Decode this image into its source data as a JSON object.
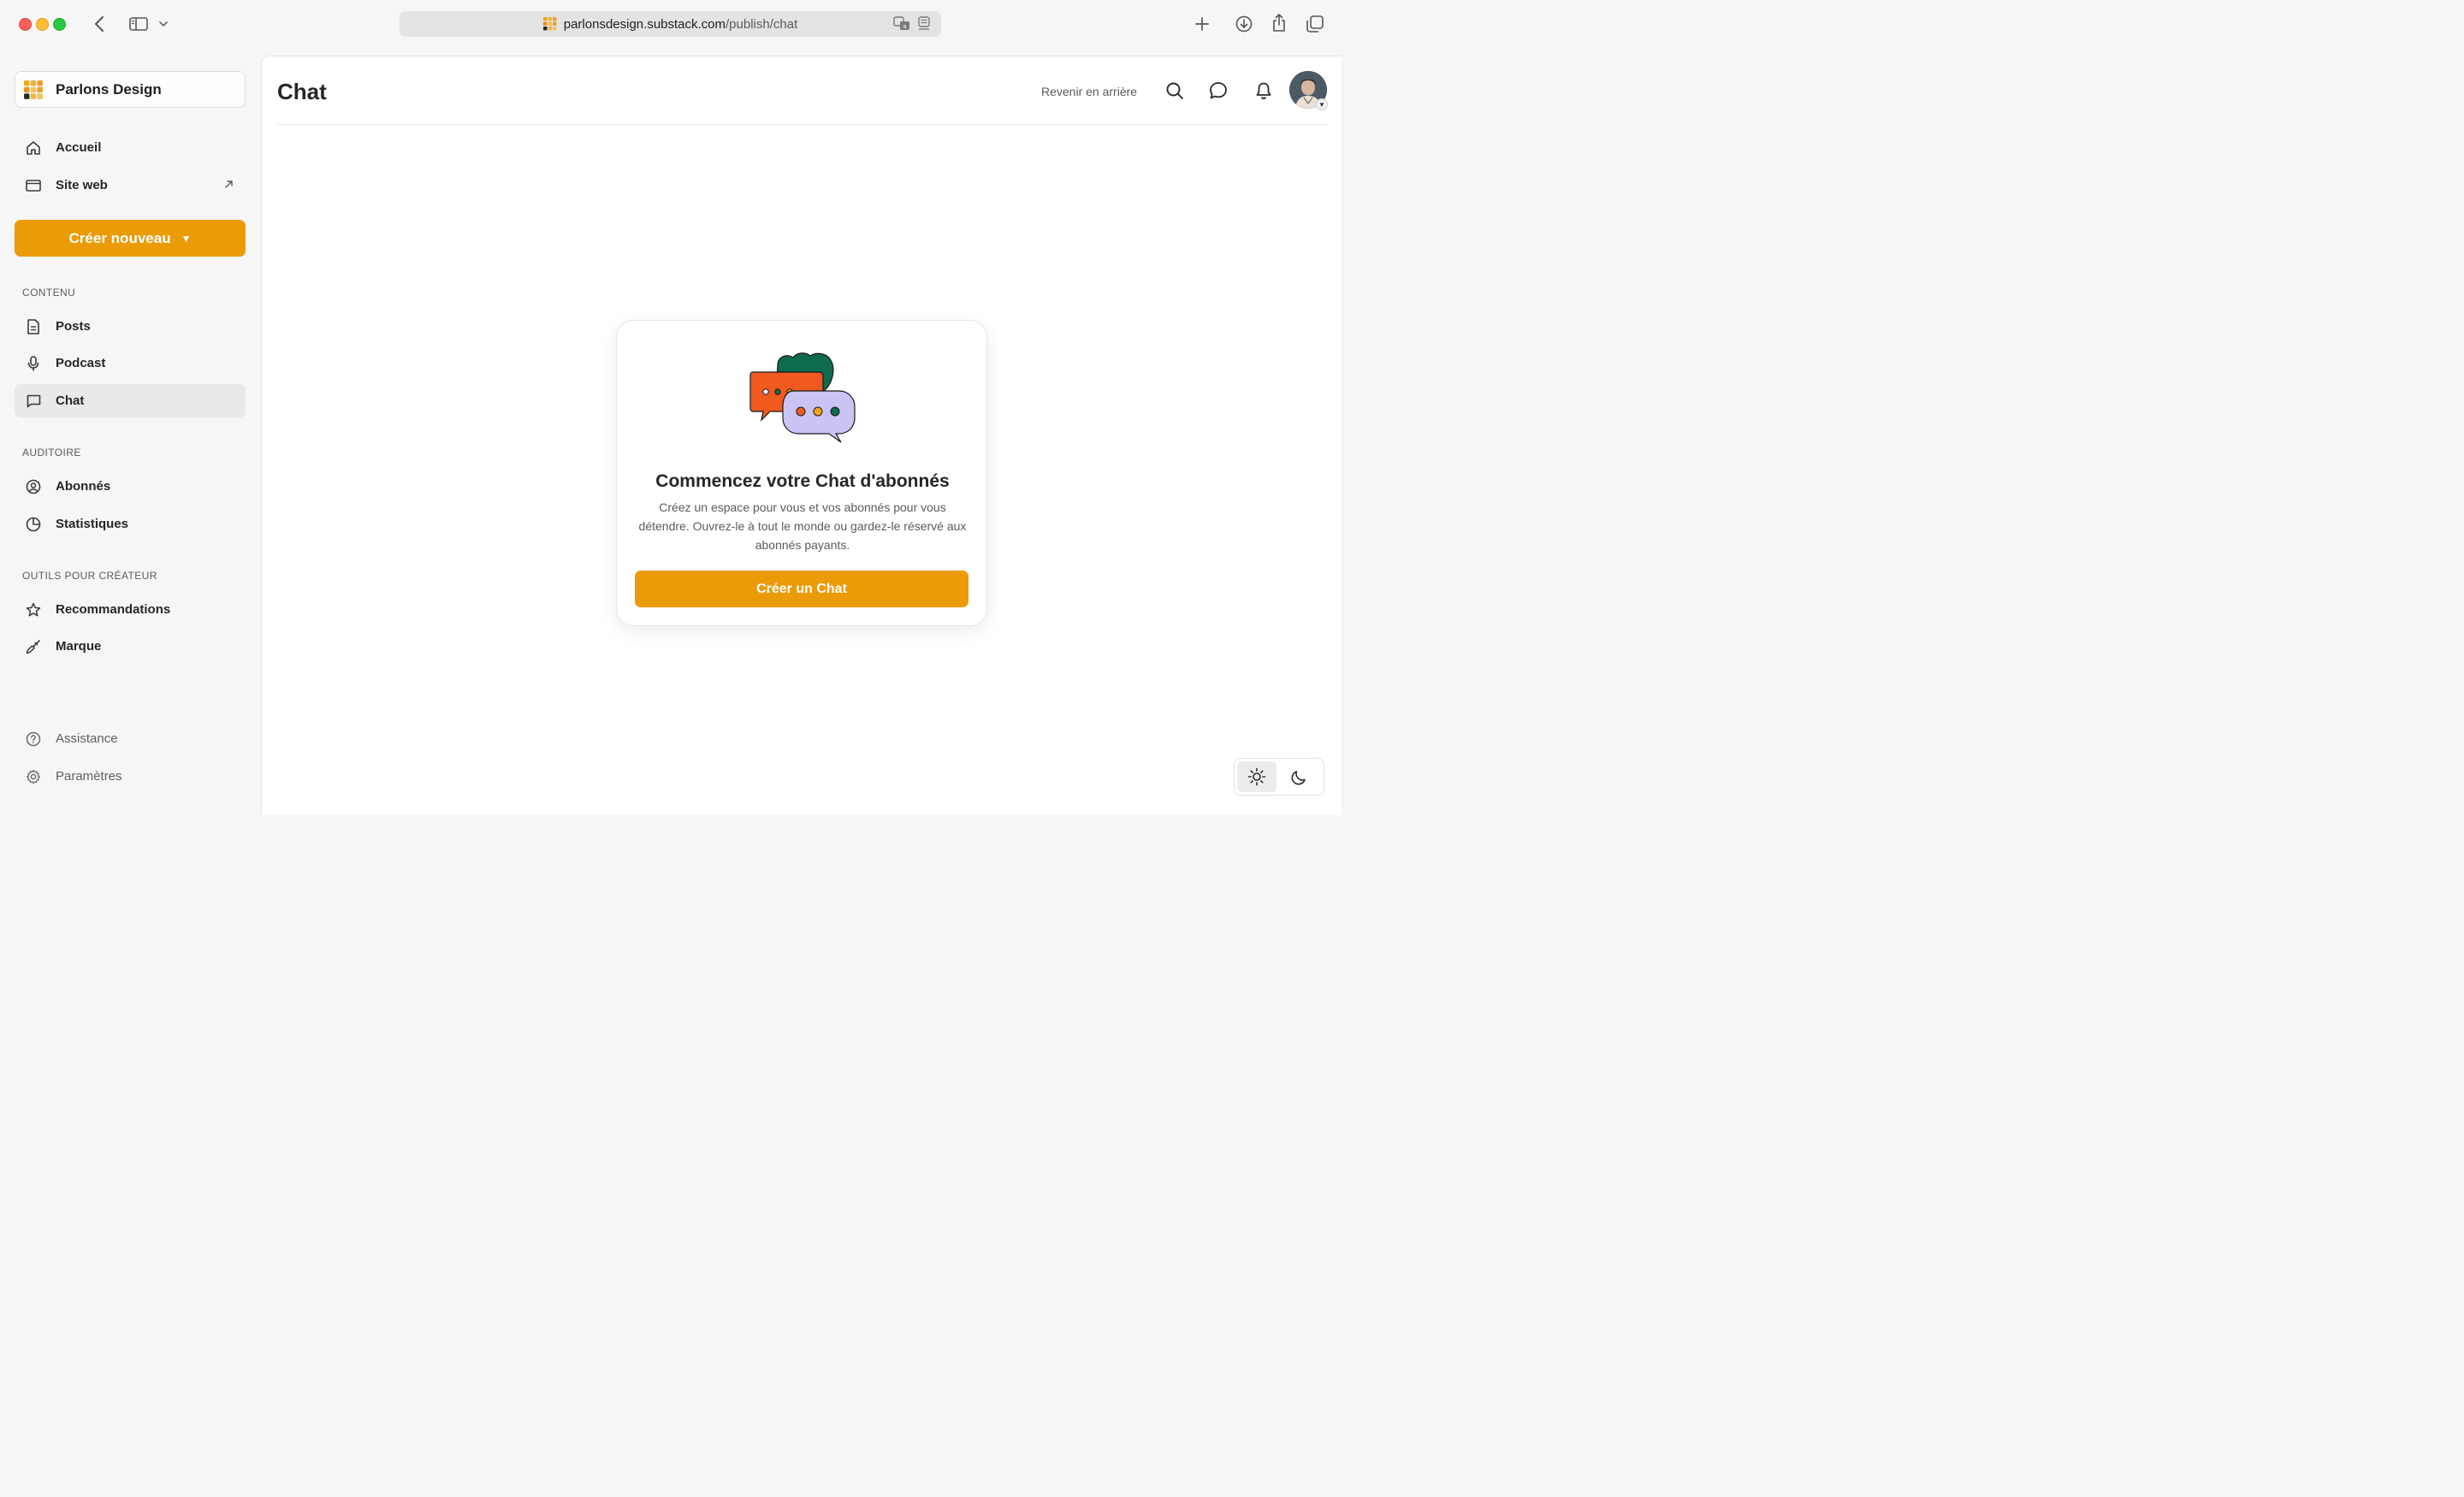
{
  "browser": {
    "url_host": "parlonsdesign.substack.com",
    "url_path": "/publish/chat"
  },
  "sidebar": {
    "publication_name": "Parlons Design",
    "top_items": [
      {
        "label": "Accueil",
        "icon": "home-icon"
      },
      {
        "label": "Site web",
        "icon": "browser-window-icon"
      }
    ],
    "create_button": "Créer nouveau",
    "sections": [
      {
        "title": "CONTENU",
        "items": [
          {
            "label": "Posts",
            "icon": "document-icon"
          },
          {
            "label": "Podcast",
            "icon": "microphone-icon"
          },
          {
            "label": "Chat",
            "icon": "chat-bubble-icon",
            "active": true
          }
        ]
      },
      {
        "title": "AUDITOIRE",
        "items": [
          {
            "label": "Abonnés",
            "icon": "user-circle-icon"
          },
          {
            "label": "Statistiques",
            "icon": "pie-chart-icon"
          }
        ]
      },
      {
        "title": "OUTILS POUR CRÉATEUR",
        "items": [
          {
            "label": "Recommandations",
            "icon": "star-icon"
          },
          {
            "label": "Marque",
            "icon": "paintbrush-icon"
          }
        ]
      }
    ],
    "bottom_items": [
      {
        "label": "Assistance",
        "icon": "help-icon"
      },
      {
        "label": "Paramètres",
        "icon": "gear-icon"
      }
    ]
  },
  "header": {
    "title": "Chat",
    "back_link": "Revenir en arrière"
  },
  "empty_state": {
    "title": "Commencez votre Chat d'abonnés",
    "description": "Créez un espace pour vous et vos abonnés pour vous détendre. Ouvrez-le à tout le monde ou gardez-le réservé aux abonnés payants.",
    "cta": "Créer un Chat"
  },
  "colors": {
    "accent": "#ec9b08",
    "illustration_green": "#0e6b4f",
    "illustration_orange": "#f05a1e",
    "illustration_lavender": "#c9c4f4"
  }
}
